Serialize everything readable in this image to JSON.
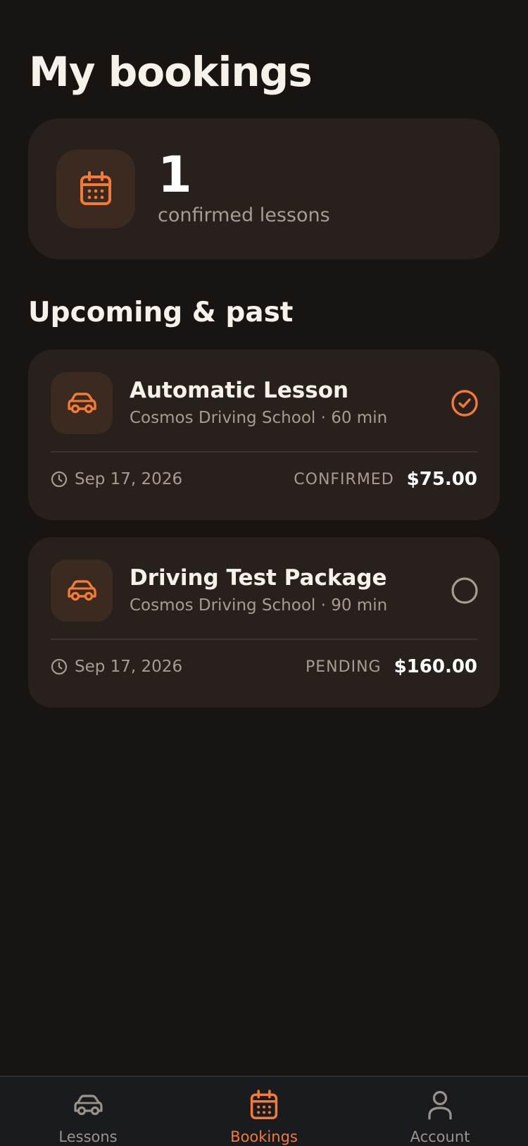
{
  "page": {
    "title": "My bookings"
  },
  "summary": {
    "count": "1",
    "label": "confirmed lessons",
    "icon": "calendar-icon"
  },
  "section": {
    "title": "Upcoming & past"
  },
  "bookings": [
    {
      "title": "Automatic Lesson",
      "subtitle": "Cosmos Driving School · 60 min",
      "date": "Sep 17, 2026",
      "status": "CONFIRMED",
      "price": "$75.00",
      "icon": "car-icon",
      "status_icon": "check-circle-icon"
    },
    {
      "title": "Driving Test Package",
      "subtitle": "Cosmos Driving School · 90 min",
      "date": "Sep 17, 2026",
      "status": "PENDING",
      "price": "$160.00",
      "icon": "car-icon",
      "status_icon": "empty-circle-icon"
    }
  ],
  "tabs": [
    {
      "label": "Lessons",
      "icon": "car-icon",
      "active": false
    },
    {
      "label": "Bookings",
      "icon": "calendar-icon",
      "active": true
    },
    {
      "label": "Account",
      "icon": "user-icon",
      "active": false
    }
  ],
  "colors": {
    "background": "#181411",
    "card": "#27201c",
    "accent": "#f47a35",
    "icon_box": "#3a2a20",
    "muted_text": "#a89c91"
  }
}
